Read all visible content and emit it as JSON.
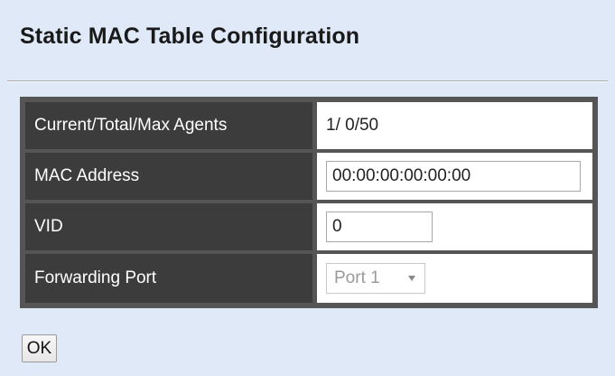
{
  "page": {
    "title": "Static MAC Table Configuration"
  },
  "config_table": {
    "rows": [
      {
        "label": "Current/Total/Max Agents",
        "value": "1/ 0/50"
      },
      {
        "label": "MAC Address",
        "value": "00:00:00:00:00:00"
      },
      {
        "label": "VID",
        "value": "0"
      },
      {
        "label": "Forwarding Port",
        "value": "Port 1"
      }
    ]
  },
  "actions": {
    "ok_label": "OK"
  },
  "icons": {
    "select_arrow": "chevron-down-icon"
  },
  "colors": {
    "background": "#dfe9f7",
    "label_cell": "#3c3c3c",
    "table_border": "#555555"
  }
}
